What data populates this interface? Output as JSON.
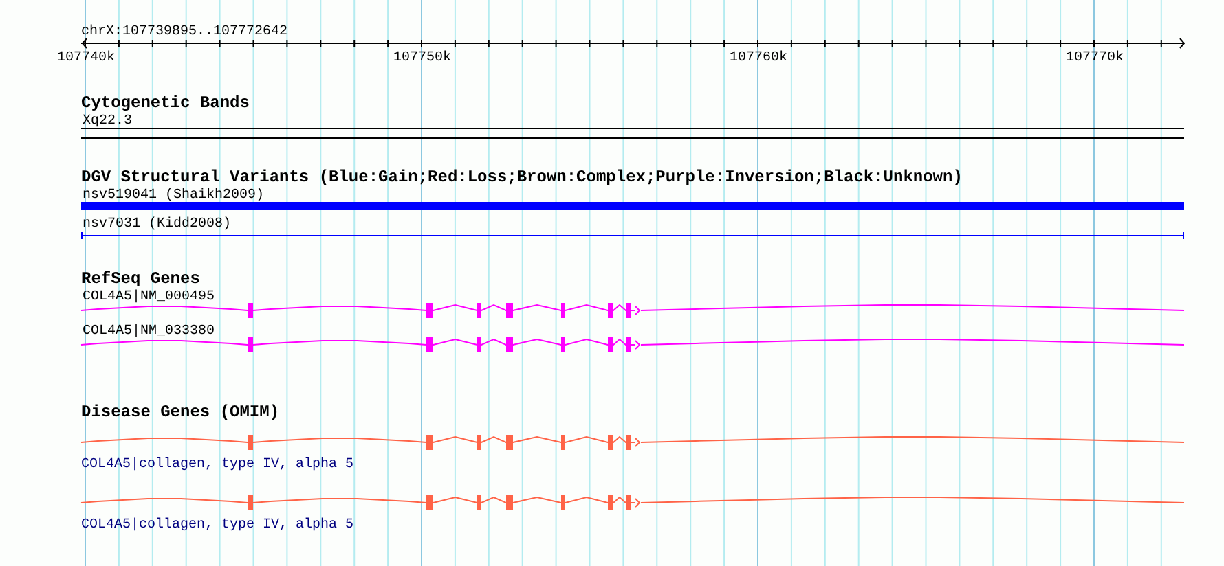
{
  "ruler": {
    "title": "chrX:107739895..107772642",
    "ticks": [
      "107740k",
      "107750k",
      "107760k",
      "107770k"
    ]
  },
  "tracks": [
    {
      "kind": "bands",
      "title": "Cytogenetic Bands",
      "features": [
        {
          "label": "Xq22.3"
        }
      ]
    },
    {
      "kind": "variants",
      "title": "DGV Structural Variants (Blue:Gain;Red:Loss;Brown:Complex;Purple:Inversion;Black:Unknown)",
      "features": [
        {
          "kind": "thick",
          "label": "nsv519041 (Shaikh2009)",
          "color": "#0000ff"
        },
        {
          "kind": "thin",
          "label": "nsv7031 (Kidd2008)",
          "color": "#0000ff"
        }
      ]
    },
    {
      "kind": "transcripts",
      "title": "RefSeq Genes",
      "color": "#ff00ff",
      "features": [
        {
          "label": "COL4A5|NM_000495"
        },
        {
          "label": "COL4A5|NM_033380"
        }
      ]
    },
    {
      "kind": "disease",
      "title": "Disease Genes (OMIM)",
      "color": "#ff6347",
      "features": [
        {
          "label": "COL4A5|collagen, type IV, alpha 5"
        },
        {
          "label": "COL4A5|collagen, type IV, alpha 5"
        }
      ]
    }
  ]
}
